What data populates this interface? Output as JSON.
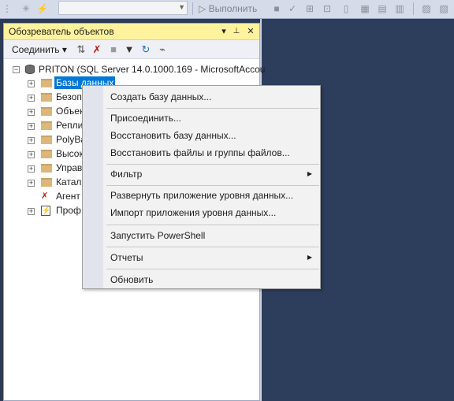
{
  "toolbar": {
    "execute_label": "Выполнить",
    "database_combo_value": ""
  },
  "panel": {
    "title": "Обозреватель объектов",
    "pin_glyph": "▾",
    "autohide_glyph": "📌",
    "close_glyph": "✕",
    "connect_label": "Соединить",
    "connect_arrow": "▾"
  },
  "tree": {
    "server": "PRITON (SQL Server 14.0.1000.169 - MicrosoftAccou",
    "items": [
      {
        "label": "Базы данных"
      },
      {
        "label": "Безоп"
      },
      {
        "label": "Объек"
      },
      {
        "label": "Репли"
      },
      {
        "label": "PolyBa"
      },
      {
        "label": "Высок"
      },
      {
        "label": "Управ"
      },
      {
        "label": "Катал"
      },
      {
        "label": "Агент"
      },
      {
        "label": "Проф"
      }
    ]
  },
  "context_menu": {
    "items": [
      {
        "label": "Создать базу данных..."
      },
      {
        "label": "Присоединить..."
      },
      {
        "label": "Восстановить базу данных..."
      },
      {
        "label": "Восстановить файлы и группы файлов..."
      },
      {
        "label": "Фильтр",
        "submenu": true
      },
      {
        "label": "Развернуть приложение уровня данных..."
      },
      {
        "label": "Импорт приложения уровня данных..."
      },
      {
        "label": "Запустить PowerShell"
      },
      {
        "label": "Отчеты",
        "submenu": true
      },
      {
        "label": "Обновить"
      }
    ]
  },
  "colors": {
    "selection": "#0078d7",
    "panel_title_bg": "#fff29d",
    "workspace_bg": "#2d3d5c"
  }
}
